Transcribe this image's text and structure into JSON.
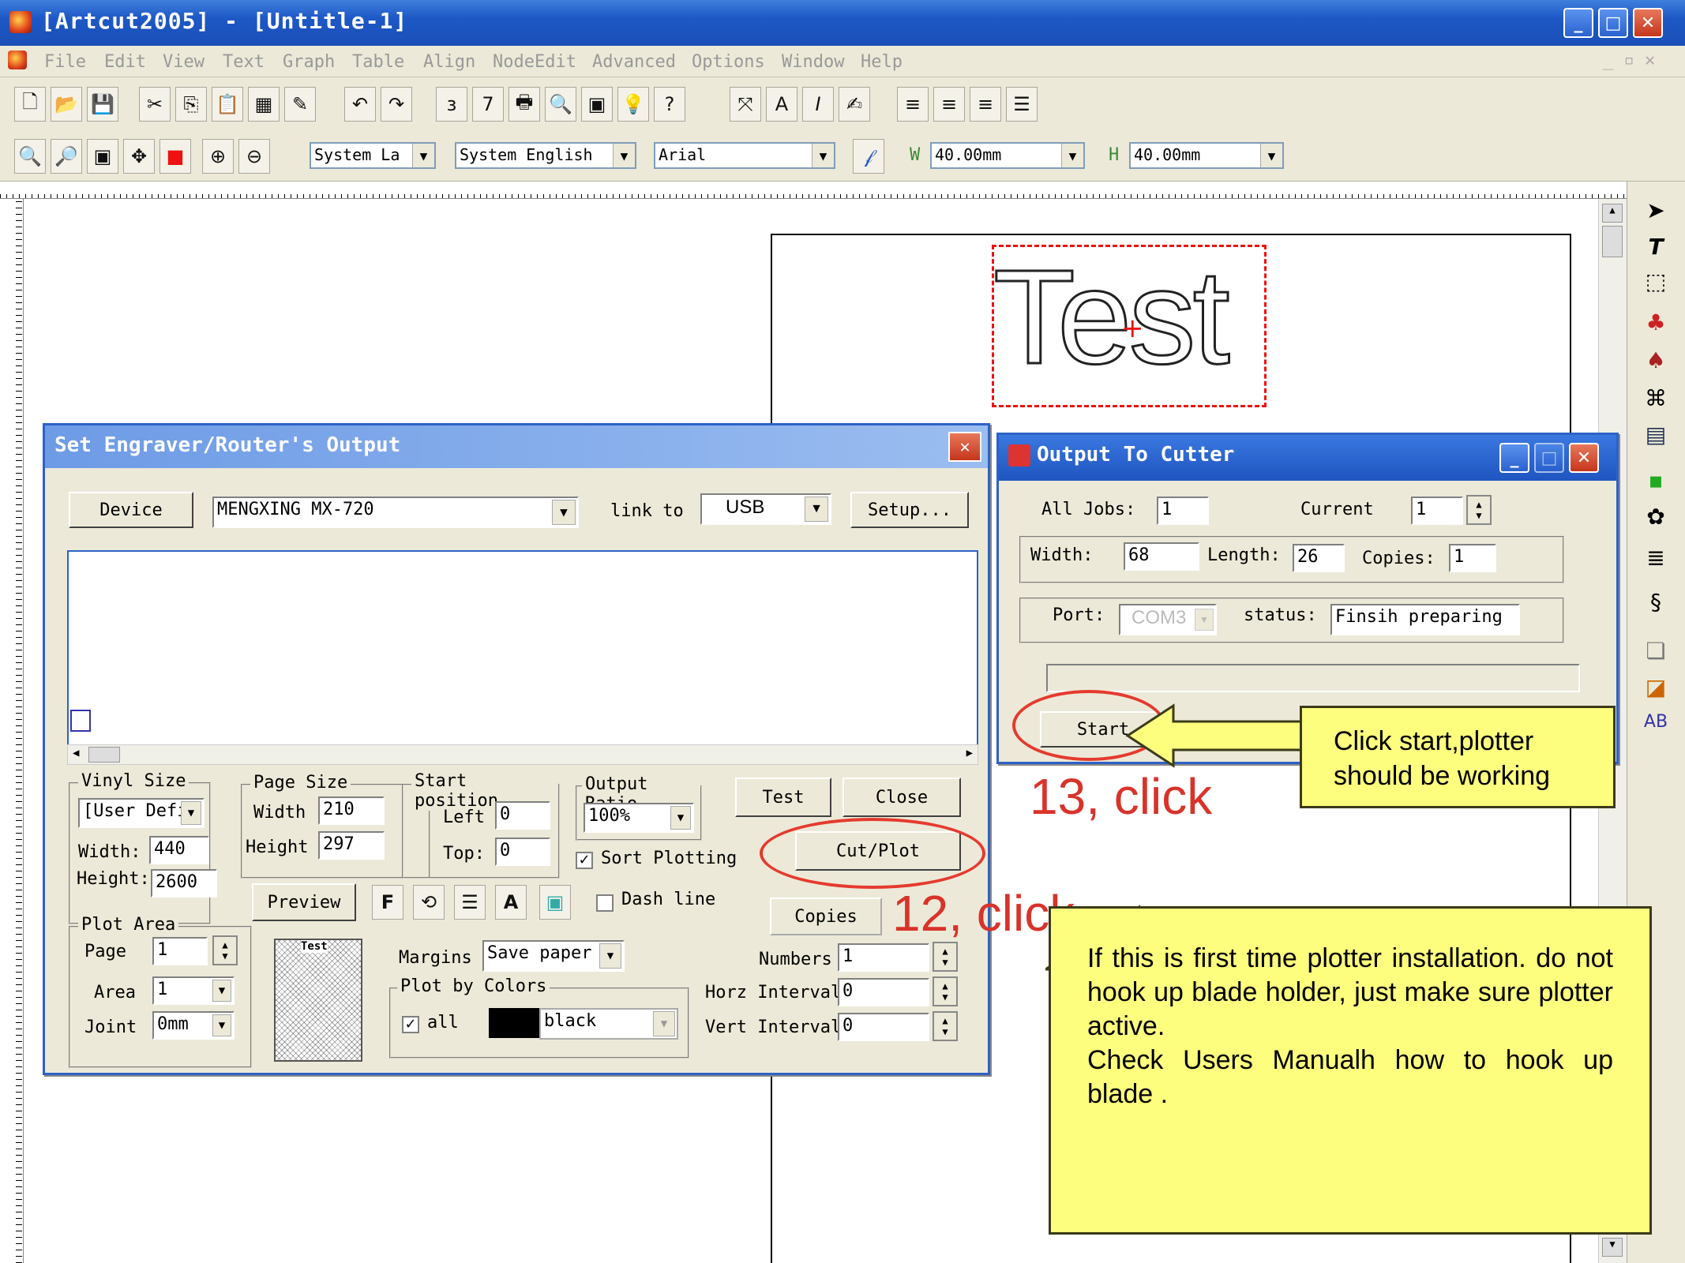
{
  "window": {
    "title": "[Artcut2005] - [Untitle-1]"
  },
  "menu": [
    "File",
    "Edit",
    "View",
    "Text",
    "Graph",
    "Table",
    "Align",
    "NodeEdit",
    "Advanced",
    "Options",
    "Window",
    "Help"
  ],
  "toolbar2": {
    "lang1": "System La",
    "lang2": "System English",
    "font": "Arial",
    "w_label": "W",
    "w_value": "40.00mm",
    "h_label": "H",
    "h_value": "40.00mm"
  },
  "canvas": {
    "test_text": "Test"
  },
  "engraver_dialog": {
    "title": "Set Engraver/Router's Output",
    "device_btn": "Device",
    "device_value": "MENGXING MX-720",
    "link_to": "link to",
    "link_value": "USB",
    "setup_btn": "Setup...",
    "vinyl_size": "Vinyl Size",
    "vinyl_value": "[User Defi",
    "vinyl_width_label": "Width:",
    "vinyl_width": "440",
    "vinyl_height_label": "Height:",
    "vinyl_height": "2600",
    "page_size": "Page Size",
    "page_width_label": "Width",
    "page_width": "210",
    "page_height_label": "Height",
    "page_height": "297",
    "start_position": "Start position",
    "left_label": "Left",
    "left_value": "0",
    "top_label": "Top:",
    "top_value": "0",
    "output_ratio": "Output Ratio",
    "ratio_value": "100%",
    "sort_plotting": "Sort Plotting",
    "test_btn": "Test",
    "close_btn": "Close",
    "cutplot_btn": "Cut/Plot",
    "preview_btn": "Preview",
    "dash_line": "Dash line",
    "copies_label": "Copies",
    "plot_area": "Plot Area",
    "page_label": "Page",
    "page_value": "1",
    "area_label": "Area",
    "area_value": "1",
    "joint_label": "Joint",
    "joint_value": "0mm",
    "margins_label": "Margins",
    "margins_value": "Save paper",
    "plot_by_colors": "Plot by Colors",
    "all_label": "all",
    "color_name": "black",
    "numbers_label": "Numbers",
    "numbers_value": "1",
    "horz_label": "Horz Interval",
    "horz_value": "0",
    "vert_label": "Vert Interval",
    "vert_value": "0",
    "thumb_text": "Test"
  },
  "cutter_dialog": {
    "title": "Output To Cutter",
    "all_jobs_label": "All Jobs:",
    "all_jobs": "1",
    "current_label": "Current",
    "current": "1",
    "width_label": "Width:",
    "width": "68",
    "length_label": "Length:",
    "length": "26",
    "copies_label": "Copies:",
    "copies": "1",
    "port_label": "Port:",
    "port_value": "COM3",
    "status_label": "status:",
    "status_value": "Finsih preparing",
    "start_btn": "Start"
  },
  "annotations": {
    "step13": "13, click",
    "step12": "12, click",
    "callout1": "Click      start,plotter should be working",
    "callout2_line1": "If this is first time plotter installation. do not hook up blade holder, just make sure plotter active.",
    "callout2_line2": "Check Users Manualh how to hook up blade ."
  },
  "colors": {
    "titlebar": "#1d58c5",
    "accent_red": "#d8332a",
    "note_yellow": "#fdfd7e"
  }
}
